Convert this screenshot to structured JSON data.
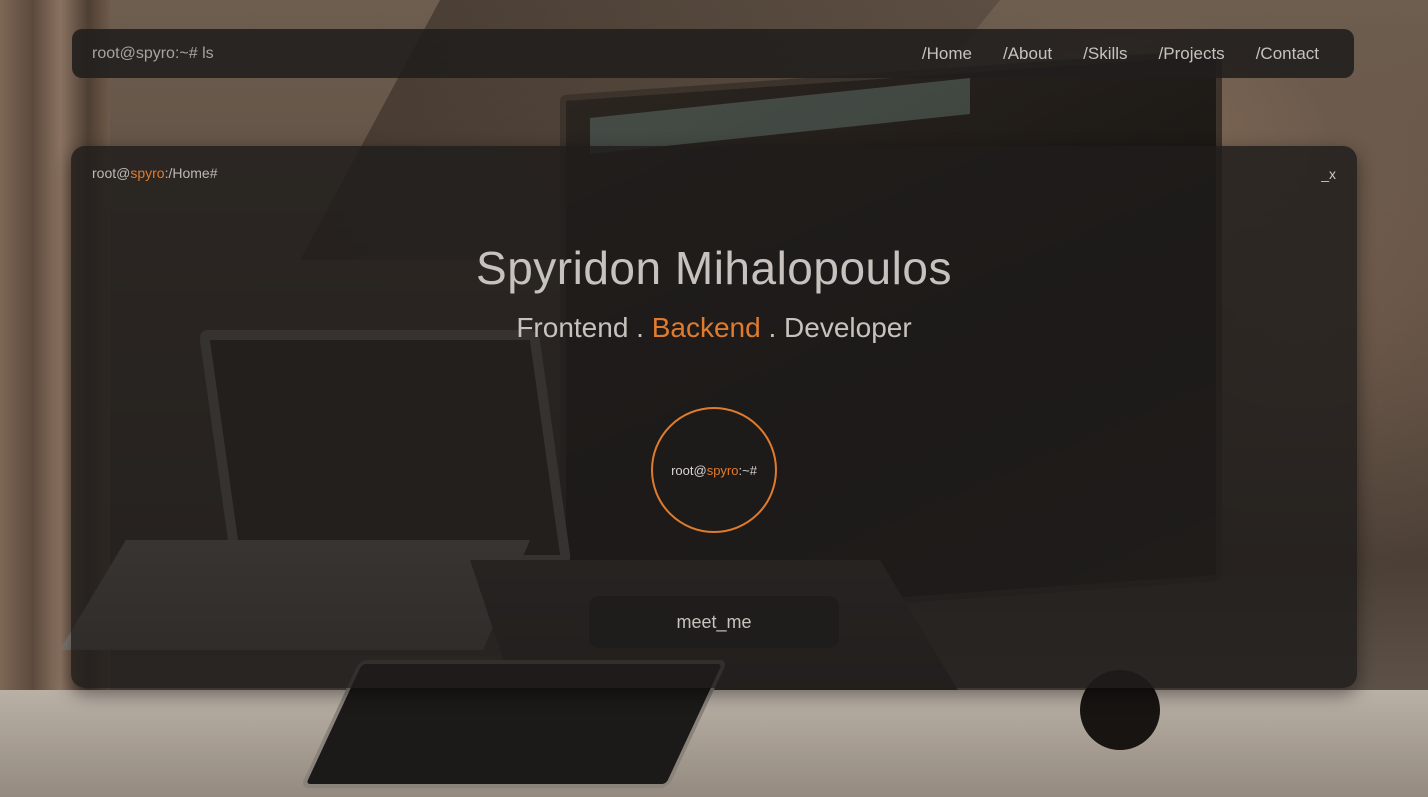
{
  "navbar": {
    "prompt": "root@spyro:~# ls",
    "links": [
      "/Home",
      "/About",
      "/Skills",
      "/Projects",
      "/Contact"
    ]
  },
  "terminal": {
    "prompt_user": "root@",
    "prompt_host": "spyro",
    "prompt_path": ":/Home#",
    "close_label": "_x"
  },
  "hero": {
    "name": "Spyridon Mihalopoulos",
    "role_part1": "Frontend . ",
    "role_part2": "Backend",
    "role_part3": " . Developer"
  },
  "avatar": {
    "user": "root@",
    "host": "spyro",
    "suffix": ":~#"
  },
  "cta": {
    "label": "meet_me"
  },
  "colors": {
    "accent": "#e07b2e",
    "panel": "#1e1c1b",
    "text": "#c7c2bd"
  }
}
